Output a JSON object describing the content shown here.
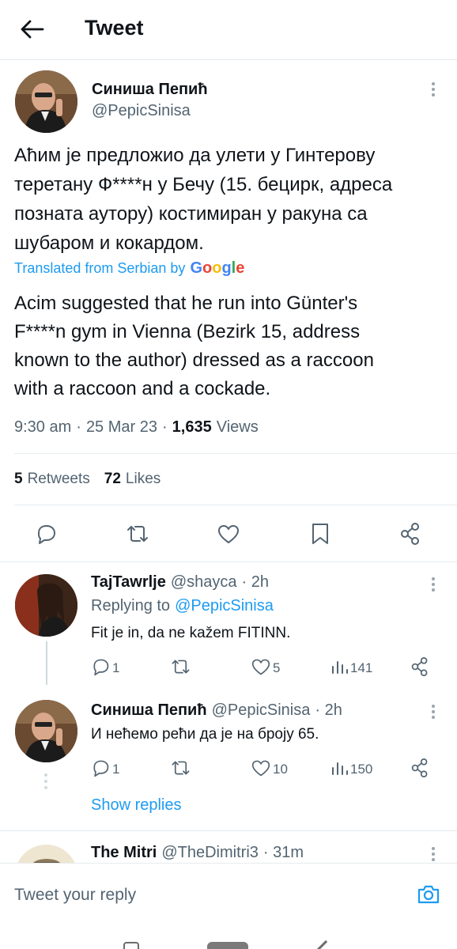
{
  "header": {
    "title": "Tweet"
  },
  "tweet": {
    "author_name": "Синиша Пепић",
    "author_handle": "@PepicSinisa",
    "text_lines": [
      "Аћим је предложио да улети у Гинтерову",
      "теретану Ф****н у Бечу (15. бецирк, адреса",
      "позната аутору) костимиран у ракуна са",
      "шубаром и кокардом."
    ],
    "translated_label": "Translated from Serbian by",
    "translator": "Google",
    "translation_lines": [
      "Acim suggested that he run into Günter's",
      "F****n gym in Vienna (Bezirk 15, address",
      "known to the author) dressed as a raccoon",
      "with a raccoon and a cockade."
    ],
    "time": "9:30 am",
    "date": "25 Mar 23",
    "views_count": "1,635",
    "views_label": "Views",
    "retweets_count": "5",
    "retweets_label": "Retweets",
    "likes_count": "72",
    "likes_label": "Likes"
  },
  "replies": [
    {
      "name": "TajTawrlje",
      "handle": "@shayca",
      "time": "· 2h",
      "replying_label": "Replying to",
      "replying_to": "@PepicSinisa",
      "text": "Fit je in, da ne kažem FITINN.",
      "reply_count": "1",
      "retweet_count": "",
      "like_count": "5",
      "view_count": "141"
    },
    {
      "name": "Синиша Пепић",
      "handle": "@PepicSinisa",
      "time": "· 2h",
      "text": "И нећемо рећи да је на броју 65.",
      "reply_count": "1",
      "retweet_count": "",
      "like_count": "10",
      "view_count": "150"
    }
  ],
  "show_replies": "Show replies",
  "third_reply": {
    "name": "The Mitri",
    "handle": "@TheDimitri3",
    "time": "· 31m"
  },
  "composer": {
    "placeholder": "Tweet your reply"
  },
  "icons": [
    "back-arrow-icon",
    "more-icon",
    "reply-icon",
    "retweet-icon",
    "like-icon",
    "bookmark-icon",
    "share-icon",
    "views-icon",
    "camera-icon"
  ]
}
